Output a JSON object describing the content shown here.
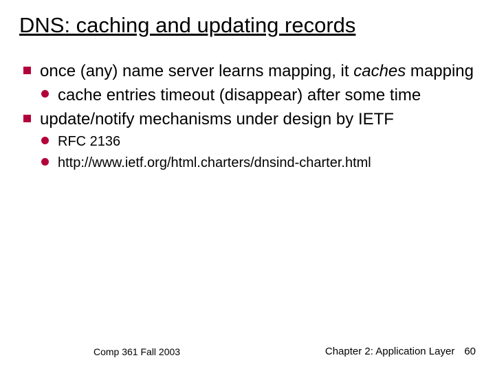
{
  "title": "DNS: caching and updating records",
  "bullets": {
    "b1": {
      "prefix": "once (any) name server learns mapping, it ",
      "italic": "caches",
      "rest": " mapping"
    },
    "b1a": "cache entries timeout (disappear) after some time",
    "b2": "update/notify mechanisms under design by IETF",
    "b2a": "RFC 2136",
    "b2b": "http://www.ietf.org/html.charters/dnsind-charter.html"
  },
  "footer": {
    "left": "Comp 361   Fall 2003",
    "right": "Chapter 2: Application Layer",
    "page": "60"
  }
}
